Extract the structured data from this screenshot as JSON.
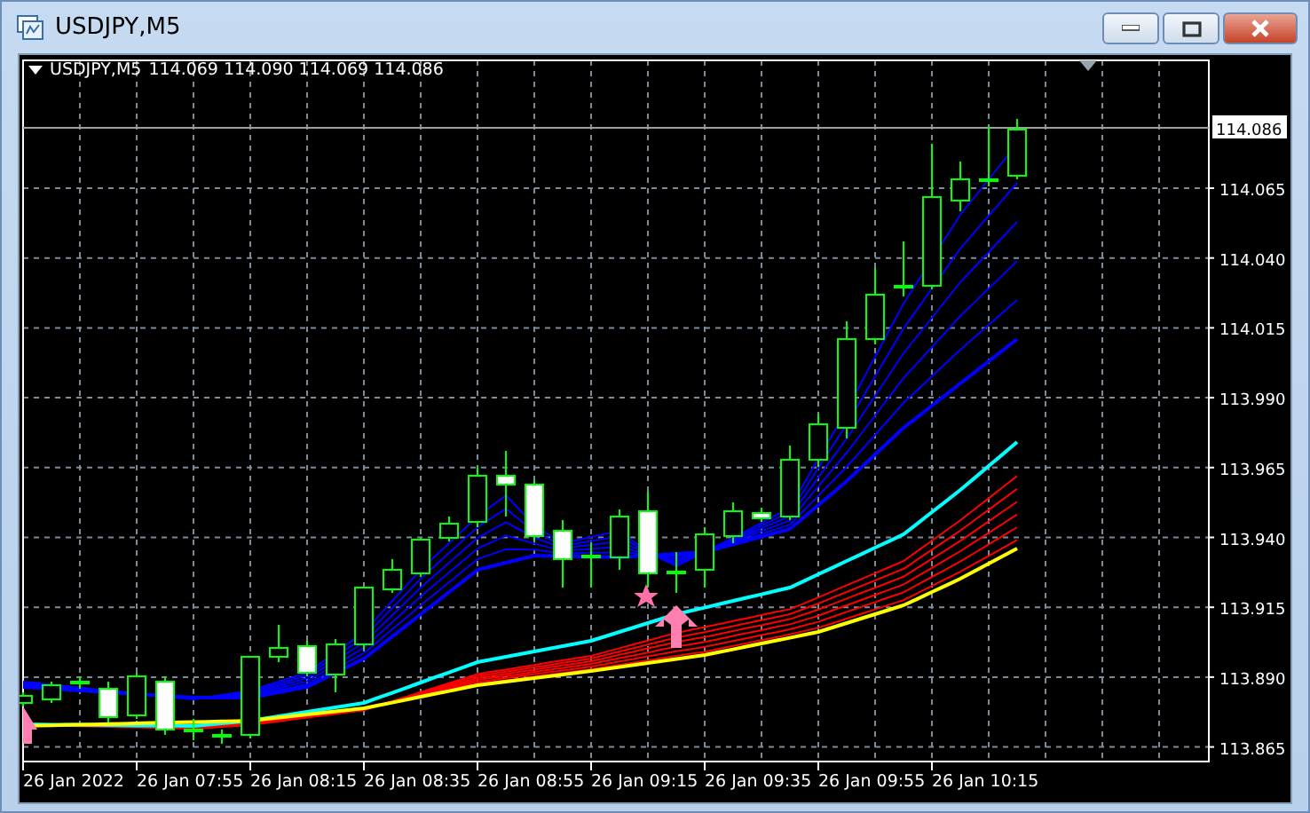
{
  "window": {
    "title": "USDJPY,M5"
  },
  "chart": {
    "header": {
      "symbol": "USDJPY,M5",
      "ohlc": "114.069 114.090 114.069 114.086"
    },
    "current_price": "114.086",
    "price_axis": [
      "114.065",
      "114.040",
      "114.015",
      "113.990",
      "113.965",
      "113.940",
      "113.915",
      "113.890",
      "113.865"
    ],
    "time_axis": [
      "26 Jan 2022",
      "26 Jan 07:55",
      "26 Jan 08:15",
      "26 Jan 08:35",
      "26 Jan 08:55",
      "26 Jan 09:15",
      "26 Jan 09:35",
      "26 Jan 09:55",
      "26 Jan 10:15"
    ]
  }
}
